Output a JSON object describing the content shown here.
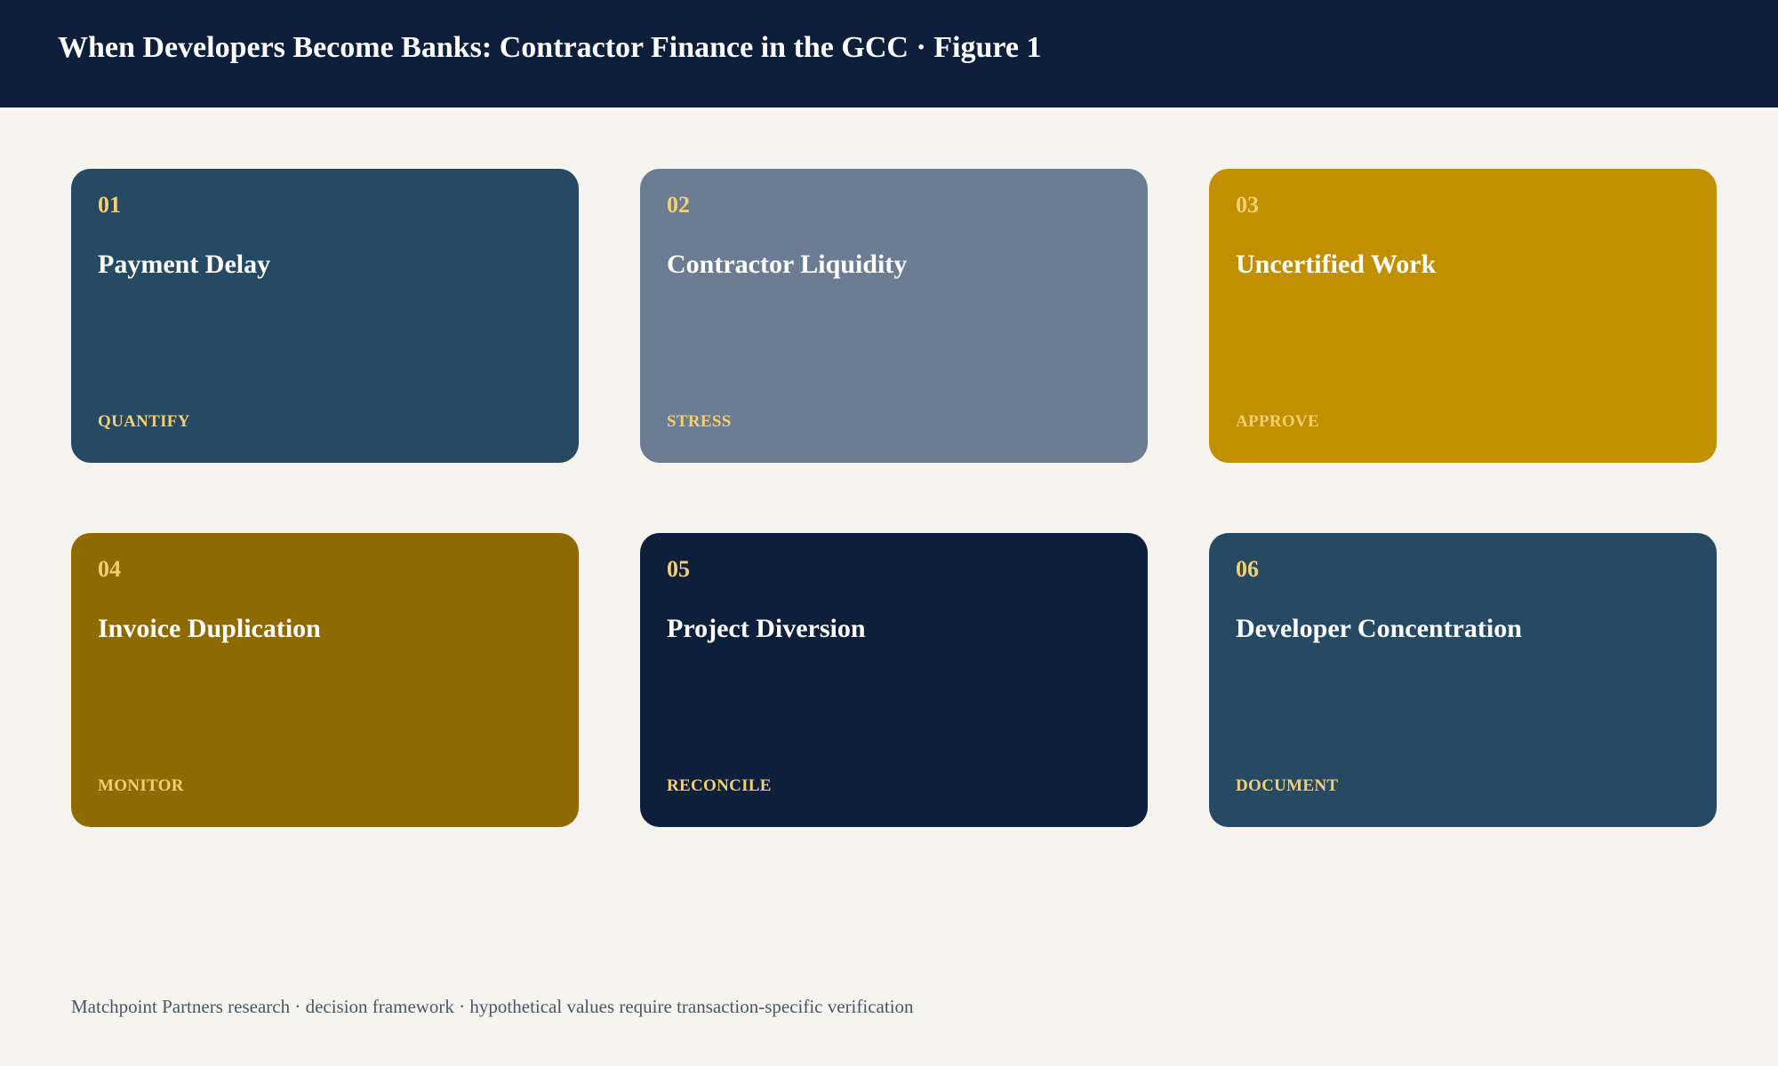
{
  "header": {
    "title": "When Developers Become Banks: Contractor Finance in the GCC · Figure 1"
  },
  "cards": [
    {
      "number": "01",
      "title": "Payment Delay",
      "action": "QUANTIFY",
      "color": "#274a64"
    },
    {
      "number": "02",
      "title": "Contractor Liquidity",
      "action": "STRESS",
      "color": "#6c7c93"
    },
    {
      "number": "03",
      "title": "Uncertified Work",
      "action": "APPROVE",
      "color": "#c09000"
    },
    {
      "number": "04",
      "title": "Invoice Duplication",
      "action": "MONITOR",
      "color": "#8f6a00"
    },
    {
      "number": "05",
      "title": "Project Diversion",
      "action": "RECONCILE",
      "color": "#0d1f3a"
    },
    {
      "number": "06",
      "title": "Developer Concentration",
      "action": "DOCUMENT",
      "color": "#274a64"
    }
  ],
  "footer": {
    "note": "Matchpoint Partners research · decision framework · hypothetical values require transaction-specific verification"
  },
  "colors": {
    "header_bg": "#0d1f3a",
    "page_bg": "#f6f4ee",
    "accent": "#f2cf72"
  }
}
